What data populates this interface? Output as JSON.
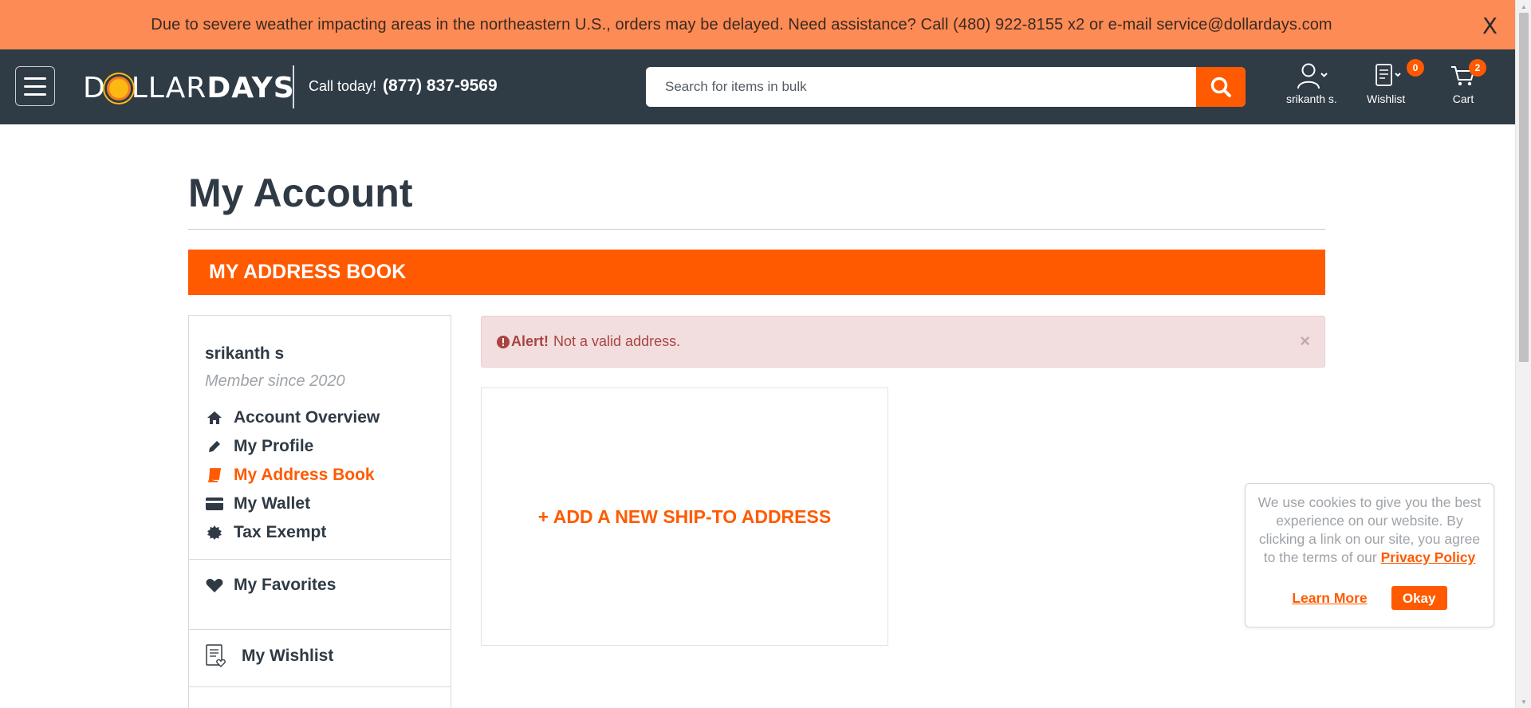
{
  "announcement": {
    "text": "Due to severe weather impacting areas in the northeastern U.S., orders may be delayed. Need assistance? Call (480) 922-8155 x2 or e-mail service@dollardays.com",
    "close_label": "X"
  },
  "header": {
    "logo_left": "D",
    "logo_mid": "LLAR",
    "logo_right": "DAYS",
    "call_label": "Call today!",
    "phone": "(877) 837-9569",
    "search_placeholder": "Search for items in bulk",
    "account_label": "srikanth s.",
    "wishlist_label": "Wishlist",
    "wishlist_count": "0",
    "cart_label": "Cart",
    "cart_count": "2"
  },
  "page": {
    "title": "My Account",
    "section_title": "MY ADDRESS BOOK"
  },
  "sidebar": {
    "user_name": "srikanth s",
    "member_since": "Member since 2020",
    "items": [
      {
        "label": "Account Overview",
        "icon": "home-icon"
      },
      {
        "label": "My Profile",
        "icon": "pencil-icon"
      },
      {
        "label": "My Address Book",
        "icon": "book-icon",
        "active": true
      },
      {
        "label": "My Wallet",
        "icon": "credit-card-icon"
      },
      {
        "label": "Tax Exempt",
        "icon": "certificate-icon"
      }
    ],
    "favorites_label": "My Favorites",
    "wishlist_label": "My Wishlist"
  },
  "alert": {
    "title": "Alert!",
    "message": "Not a valid address.",
    "close_label": "×"
  },
  "address_book": {
    "add_label": "+ ADD A NEW SHIP-TO ADDRESS"
  },
  "cookie_banner": {
    "text": "We use cookies to give you the best experience on our website. By clicking a link on our site, you agree to the terms of our",
    "privacy_link": "Privacy Policy",
    "learn_more": "Learn More",
    "okay": "Okay"
  },
  "colors": {
    "brand_orange": "#ff5a00",
    "header_dark": "#2f3b45",
    "announce_bg": "#fd8b55",
    "alert_bg": "#f2dede"
  }
}
